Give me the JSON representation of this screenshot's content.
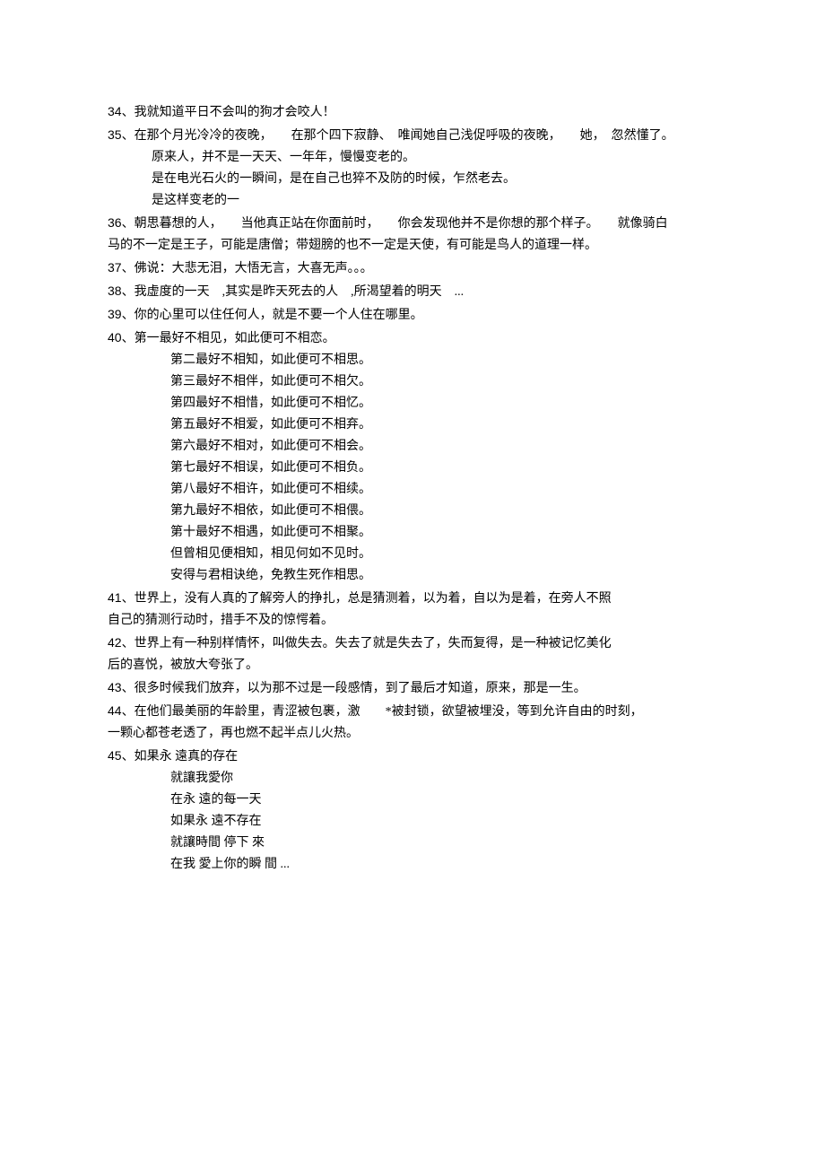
{
  "items": [
    {
      "n": "34",
      "lines": [
        "我就知道平日不会叫的狗才会咬人！"
      ]
    },
    {
      "n": "35",
      "lines": [
        "在那个月光冷冷的夜晚，　　在那个四下寂静、　唯闻她自己浅促呼吸的夜晚，　　她，　忽然懂了。",
        "原来人，并不是一天天、一年年，慢慢变老的。",
        "是在电光石火的一瞬间，是在自己也猝不及防的时候，乍然老去。",
        "是这样变老的一"
      ]
    },
    {
      "n": "36",
      "lines": [
        "朝思暮想的人，　　当他真正站在你面前时，　　你会发现他并不是你想的那个样子。　　就像骑白",
        "马的不一定是王子，可能是唐僧；带翅膀的也不一定是天使，有可能是鸟人的道理一样。"
      ],
      "noIndentCont": true
    },
    {
      "n": "37",
      "lines": [
        "佛说：大悲无泪，大悟无言，大喜无声。。。"
      ]
    },
    {
      "n": "38",
      "lines": [
        "我虚度的一天　,其实是昨天死去的人　,所渴望着的明天　..."
      ]
    },
    {
      "n": "39",
      "lines": [
        "你的心里可以住任何人，就是不要一个人住在哪里。"
      ]
    },
    {
      "n": "40",
      "lines": [
        "第一最好不相见，如此便可不相恋。",
        "第二最好不相知，如此便可不相思。",
        "第三最好不相伴，如此便可不相欠。",
        "第四最好不相惜，如此便可不相忆。",
        "第五最好不相爱，如此便可不相弃。",
        "第六最好不相对，如此便可不相会。",
        "第七最好不相误，如此便可不相负。",
        "第八最好不相许，如此便可不相续。",
        "第九最好不相依，如此便可不相偎。",
        "第十最好不相遇，如此便可不相聚。",
        "但曾相见便相知，相见何如不见时。",
        "安得与君相诀绝，免教生死作相思。"
      ],
      "deep": true
    },
    {
      "n": "41",
      "lines": [
        "世界上，没有人真的了解旁人的挣扎，总是猜测着，以为着，自以为是着，在旁人不照",
        "自己的猜测行动时，措手不及的惊愕着。"
      ],
      "noIndentCont": true
    },
    {
      "n": "42",
      "lines": [
        "世界上有一种别样情怀，叫做失去。失去了就是失去了，失而复得，是一种被记忆美化",
        "后的喜悦，被放大夸张了。"
      ],
      "noIndentCont": true
    },
    {
      "n": "43",
      "lines": [
        "很多时候我们放弃，以为那不过是一段感情，到了最后才知道，原来，那是一生。"
      ]
    },
    {
      "n": "44",
      "lines": [
        "在他们最美丽的年龄里，青涩被包裹，激　　*被封锁，欲望被埋没，等到允许自由的时刻，",
        "一颗心都苍老透了，再也燃不起半点儿火热。"
      ],
      "noIndentCont": true
    },
    {
      "n": "45",
      "lines": [
        "如果永 遠真的存在",
        "就讓我愛你",
        "在永 遠的每一天",
        "如果永 遠不存在",
        "就讓時間 停下 來",
        "在我 愛上你的瞬 間 ..."
      ],
      "deep": true
    }
  ]
}
